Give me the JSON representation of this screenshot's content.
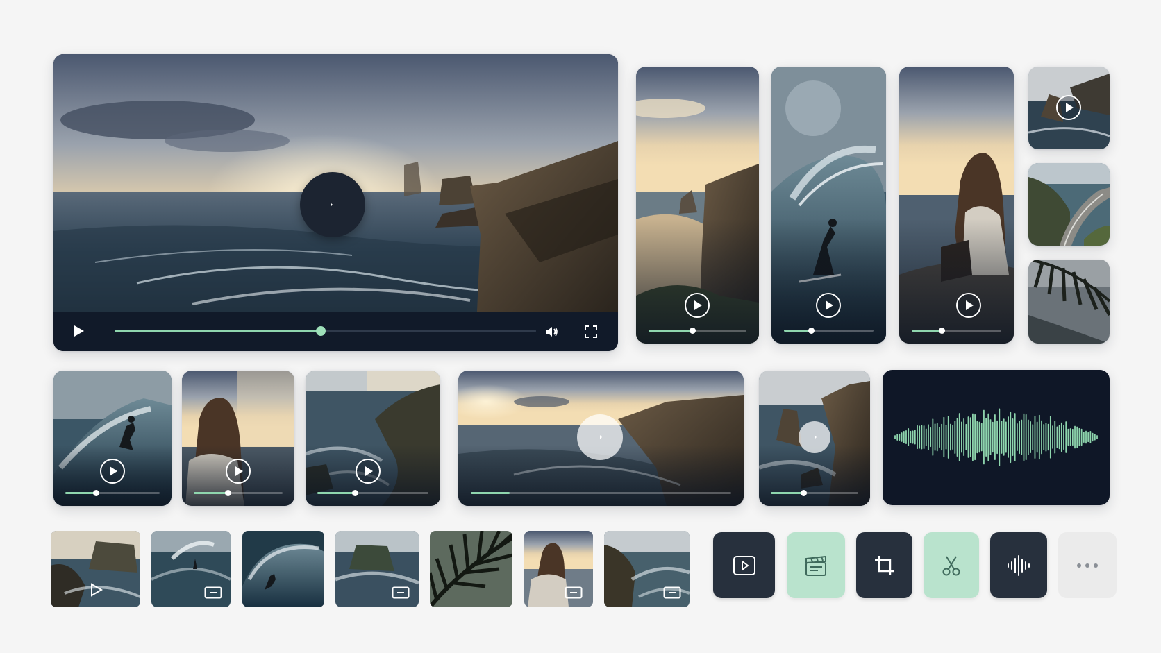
{
  "colors": {
    "background": "#f5f5f5",
    "accent": "#8fd6ae",
    "dark_panel": "#111a29",
    "tool_dark": "#27303d",
    "tool_mint": "#b9e3cd",
    "tool_light": "#ebebeb"
  },
  "hero_player": {
    "scene": "sunset-sea-cliffs",
    "progress": 0.49,
    "icons": [
      "play-icon",
      "volume-icon",
      "fullscreen-icon"
    ]
  },
  "vertical_clips": [
    {
      "scene": "cliff-beach-sunset",
      "progress": 0.45
    },
    {
      "scene": "surfer-barrel-wave",
      "progress": 0.3
    },
    {
      "scene": "woman-on-rock",
      "progress": 0.33
    }
  ],
  "small_clips": [
    {
      "scene": "sea-stack",
      "has_play": true
    },
    {
      "scene": "coastal-road",
      "has_play": false
    },
    {
      "scene": "palm-frond",
      "has_play": false
    }
  ],
  "mid_clips": [
    {
      "scene": "surfer-wave",
      "progress": 0.32
    },
    {
      "scene": "woman-sunset",
      "progress": 0.38
    },
    {
      "scene": "rocky-coast",
      "progress": 0.34
    },
    {
      "scene": "wide-cliffs-sunset",
      "progress": 0.15
    },
    {
      "scene": "sea-stack-cliff",
      "progress": 0.37
    }
  ],
  "audio_card": {
    "type": "waveform"
  },
  "thumbnails": [
    {
      "scene": "sea-stack",
      "icon": "play-icon"
    },
    {
      "scene": "surfer-spray",
      "icon": "screen-icon"
    },
    {
      "scene": "surfer-barrel",
      "icon": ""
    },
    {
      "scene": "sea-rock",
      "icon": "screen-icon"
    },
    {
      "scene": "palm",
      "icon": ""
    },
    {
      "scene": "woman-sunset",
      "icon": "screen-icon"
    },
    {
      "scene": "coast-waves",
      "icon": "screen-icon"
    }
  ],
  "toolbar": [
    {
      "icon": "play-box-icon",
      "style": "dark"
    },
    {
      "icon": "clapperboard-icon",
      "style": "mint"
    },
    {
      "icon": "crop-icon",
      "style": "dark"
    },
    {
      "icon": "scissors-icon",
      "style": "mint"
    },
    {
      "icon": "waveform-icon",
      "style": "dark"
    },
    {
      "icon": "more-icon",
      "style": "light"
    }
  ]
}
